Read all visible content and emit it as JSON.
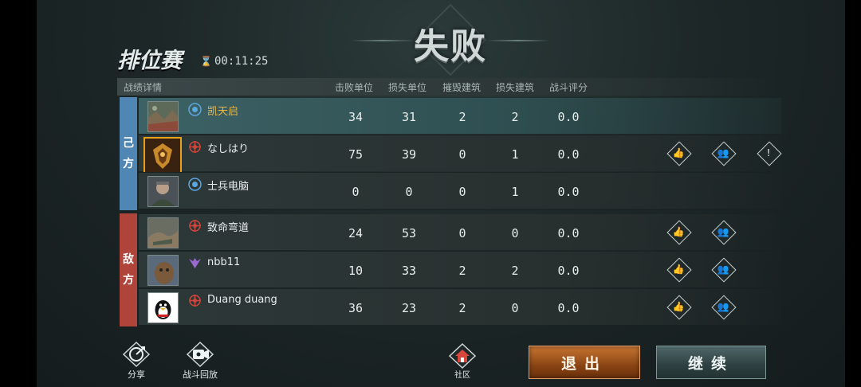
{
  "header": {
    "result": "失败",
    "mode": "排位赛",
    "timer": "00:11:25"
  },
  "table": {
    "section_label": "战绩详情",
    "columns": [
      "击败单位",
      "损失单位",
      "摧毁建筑",
      "损失建筑",
      "战斗评分"
    ]
  },
  "sides": {
    "ally": [
      "己",
      "方"
    ],
    "enemy": [
      "敌",
      "方"
    ]
  },
  "players": [
    {
      "name": "凯天启",
      "kills": "34",
      "lost_units": "31",
      "destroyed_buildings": "2",
      "lost_buildings": "2",
      "score": "0.0",
      "rank_icon": "blue-rank-icon",
      "avatar": "map-thumbnail"
    },
    {
      "name": "なしはり",
      "kills": "75",
      "lost_units": "39",
      "destroyed_buildings": "0",
      "lost_buildings": "1",
      "score": "0.0",
      "rank_icon": "red-rank-icon",
      "avatar": "gold-eagle-portrait"
    },
    {
      "name": "士兵电脑",
      "kills": "0",
      "lost_units": "0",
      "destroyed_buildings": "0",
      "lost_buildings": "1",
      "score": "0.0",
      "rank_icon": "blue-rank-icon",
      "avatar": "soldier-portrait"
    },
    {
      "name": "致命弯道",
      "kills": "24",
      "lost_units": "53",
      "destroyed_buildings": "0",
      "lost_buildings": "0",
      "score": "0.0",
      "rank_icon": "red-rank-icon",
      "avatar": "map-thumbnail"
    },
    {
      "name": "nbb11",
      "kills": "10",
      "lost_units": "33",
      "destroyed_buildings": "2",
      "lost_buildings": "2",
      "score": "0.0",
      "rank_icon": "purple-rank-icon",
      "avatar": "animal-photo"
    },
    {
      "name": "Duang duang",
      "kills": "36",
      "lost_units": "23",
      "destroyed_buildings": "2",
      "lost_buildings": "0",
      "score": "0.0",
      "rank_icon": "red-rank-icon",
      "avatar": "penguin-avatar"
    }
  ],
  "footer": {
    "share": "分享",
    "replay": "战斗回放",
    "community": "社区",
    "exit": "退出",
    "continue": "继续"
  },
  "colors": {
    "ally": "#4f86b3",
    "enemy": "#b0443b",
    "highlight_row": "#3d6265",
    "exit_button": "#c77632",
    "name_highlight": "#e8b64a"
  }
}
